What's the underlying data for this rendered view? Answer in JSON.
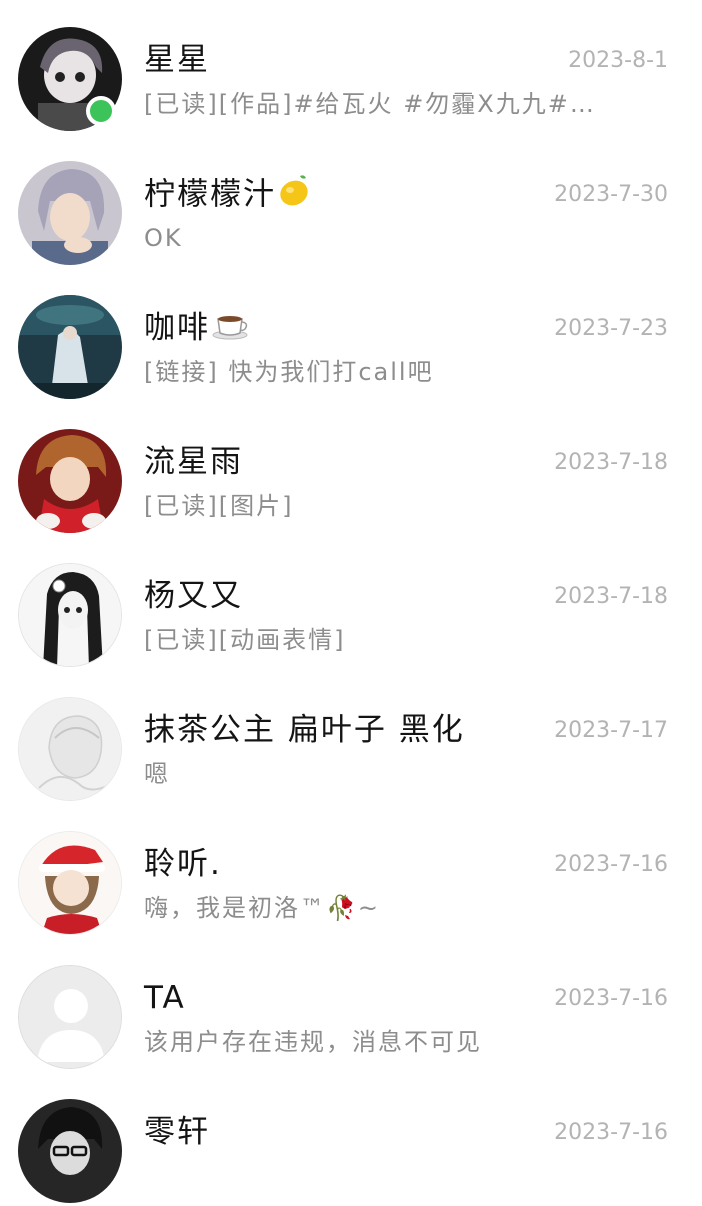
{
  "conversations": [
    {
      "name": "星星",
      "date": "2023-8-1",
      "preview": "[已读][作品]#给瓦火 #勿霾X九九#…",
      "online": true,
      "avatar_icon": "anime-girl-avatar-dark"
    },
    {
      "name": "柠檬檬汁",
      "name_emoji": "lemon-icon",
      "date": "2023-7-30",
      "preview": "OK",
      "avatar_icon": "anime-boy-silver-hair-avatar"
    },
    {
      "name": "咖啡",
      "name_emoji": "coffee-cup-icon",
      "date": "2023-7-23",
      "preview": "[链接] 快为我们打call吧",
      "avatar_icon": "underwater-figure-avatar"
    },
    {
      "name": "流星雨",
      "date": "2023-7-18",
      "preview": "[已读][图片]",
      "avatar_icon": "anime-red-scarf-avatar"
    },
    {
      "name": "杨又又",
      "date": "2023-7-18",
      "preview": "[已读][动画表情]",
      "avatar_icon": "anime-girl-black-hair-avatar"
    },
    {
      "name": "抹茶公主 扁叶子 黑化",
      "date": "2023-7-17",
      "preview": "嗯",
      "avatar_icon": "sketch-avatar"
    },
    {
      "name": "聆听.",
      "date": "2023-7-16",
      "preview": "嗨，我是初洛™🥀~",
      "avatar_icon": "anime-christmas-girl-avatar"
    },
    {
      "name": "TA",
      "date": "2023-7-16",
      "preview": "该用户存在违规，消息不可见",
      "avatar_icon": "default-user-avatar"
    },
    {
      "name": "零轩",
      "date": "2023-7-16",
      "preview": "",
      "avatar_icon": "anime-glasses-boy-avatar"
    }
  ],
  "colors": {
    "online": "#3cc45a",
    "name": "#141414",
    "preview": "#8d8d8d",
    "date": "#b3b3b3"
  }
}
